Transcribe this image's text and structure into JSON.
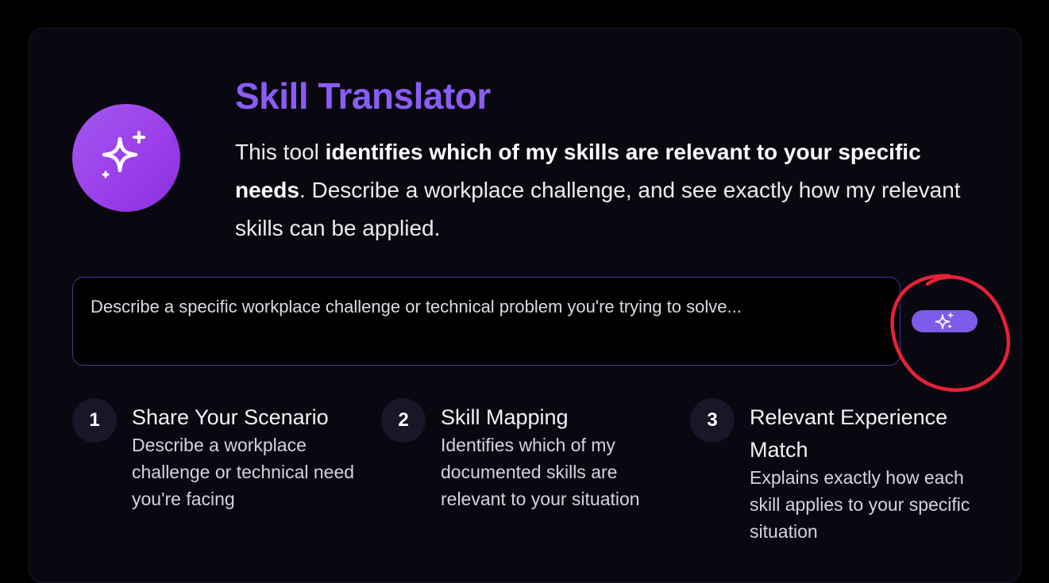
{
  "header": {
    "title": "Skill Translator",
    "desc_lead": "This tool ",
    "desc_bold": "identifies which of my skills are relevant to your specific needs",
    "desc_rest": ". Describe a workplace challenge, and see exactly how my relevant skills can be applied."
  },
  "input": {
    "placeholder": "Describe a specific workplace challenge or technical problem you're trying to solve...",
    "value": ""
  },
  "steps": [
    {
      "number": "1",
      "title": "Share Your Scenario",
      "description": "Describe a workplace challenge or technical need you're facing"
    },
    {
      "number": "2",
      "title": "Skill Mapping",
      "description": "Identifies which of my documented skills are relevant to your situation"
    },
    {
      "number": "3",
      "title": "Relevant Experience Match",
      "description": "Explains exactly how each skill applies to your specific situation"
    }
  ],
  "icons": {
    "logo": "sparkles-icon",
    "send": "sparkles-icon"
  },
  "colors": {
    "accent": "#8b5cf6",
    "logo_gradient_start": "#a258f0",
    "logo_gradient_end": "#8a2fe0",
    "button": "#7c5ce8",
    "annotation": "#e8213a"
  }
}
